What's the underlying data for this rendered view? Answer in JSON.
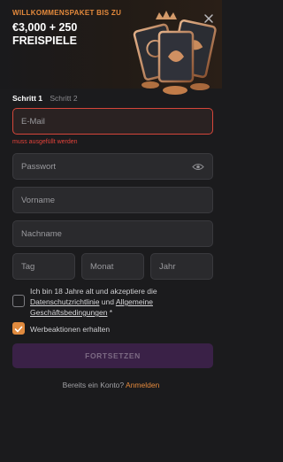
{
  "promo": {
    "headline": "WILLKOMMENSPAKET BIS ZU",
    "amount_line1": "€3,000 + 250",
    "amount_line2": "FREISPIELE"
  },
  "steps": [
    {
      "label": "Schritt 1",
      "active": true
    },
    {
      "label": "Schritt 2",
      "active": false
    }
  ],
  "form": {
    "email": {
      "placeholder": "E-Mail",
      "error": "muss ausgefüllt werden"
    },
    "password": {
      "placeholder": "Passwort"
    },
    "first_name": {
      "placeholder": "Vorname"
    },
    "last_name": {
      "placeholder": "Nachname"
    },
    "day": {
      "placeholder": "Tag"
    },
    "month": {
      "placeholder": "Monat"
    },
    "year": {
      "placeholder": "Jahr"
    }
  },
  "terms": {
    "text_before": "Ich bin 18 Jahre alt und akzeptiere die ",
    "privacy_link": "Datenschutzrichtlinie",
    "text_mid": " und ",
    "terms_link_1": "Allgemeine",
    "terms_link_2": "Geschäftsbedingungen",
    "suffix": " *",
    "checked": false
  },
  "marketing": {
    "label": "Werbeaktionen erhalten",
    "checked": true
  },
  "submit_label": "FORTSETZEN",
  "login": {
    "prompt": "Bereits ein Konto? ",
    "link": "Anmelden"
  },
  "colors": {
    "accent": "#e58a3c",
    "error": "#e2423a",
    "submit_bg": "#3a2147"
  }
}
